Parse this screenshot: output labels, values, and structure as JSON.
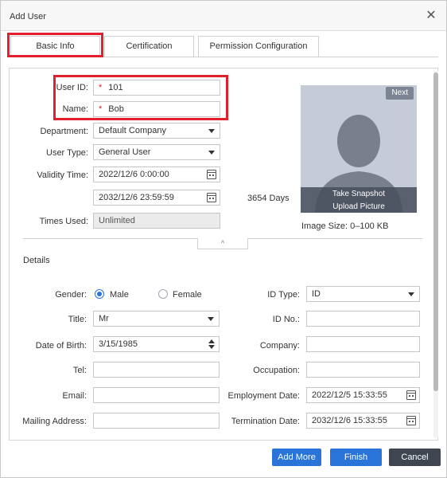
{
  "window": {
    "title": "Add User"
  },
  "tabs": [
    {
      "label": "Basic Info"
    },
    {
      "label": "Certification"
    },
    {
      "label": "Permission Configuration"
    }
  ],
  "basic": {
    "user_id": {
      "label": "User ID:",
      "required_mark": "*",
      "value": "101"
    },
    "name": {
      "label": "Name:",
      "required_mark": "*",
      "value": "Bob"
    },
    "department": {
      "label": "Department:",
      "value": "Default Company"
    },
    "user_type": {
      "label": "User Type:",
      "value": "General User"
    },
    "validity": {
      "label": "Validity Time:",
      "start": "2022/12/6 0:00:00",
      "end": "2032/12/6 23:59:59",
      "days": "3654",
      "days_unit": "Days"
    },
    "times_used": {
      "label": "Times Used:",
      "value": "Unlimited"
    }
  },
  "photo": {
    "next_label": "Next",
    "snapshot_label": "Take Snapshot",
    "upload_label": "Upload Picture",
    "size_label": "Image Size: 0–100 KB"
  },
  "details": {
    "heading": "Details",
    "gender": {
      "label": "Gender:",
      "male": "Male",
      "female": "Female",
      "selected": "Male"
    },
    "title": {
      "label": "Title:",
      "value": "Mr"
    },
    "dob": {
      "label": "Date of Birth:",
      "value": "3/15/1985"
    },
    "tel": {
      "label": "Tel:",
      "value": ""
    },
    "email": {
      "label": "Email:",
      "value": ""
    },
    "mailing": {
      "label": "Mailing Address:",
      "value": ""
    },
    "id_type": {
      "label": "ID Type:",
      "value": "ID"
    },
    "id_no": {
      "label": "ID No.:",
      "value": ""
    },
    "company": {
      "label": "Company:",
      "value": ""
    },
    "occupation": {
      "label": "Occupation:",
      "value": ""
    },
    "employment_date": {
      "label": "Employment Date:",
      "value": "2022/12/5 15:33:55"
    },
    "termination_date": {
      "label": "Termination Date:",
      "value": "2032/12/6 15:33:55"
    }
  },
  "buttons": {
    "add_more": "Add More",
    "finish": "Finish",
    "cancel": "Cancel"
  },
  "colors": {
    "accent": "#2a73d8",
    "highlight": "#e0202a",
    "dark_button": "#3f4651"
  },
  "icons": {
    "close": "close-icon",
    "calendar": "calendar-icon",
    "dropdown": "chevron-down-icon",
    "spinner": "spinner-icon",
    "collapse": "chevron-up-icon",
    "avatar": "avatar-placeholder-icon"
  }
}
